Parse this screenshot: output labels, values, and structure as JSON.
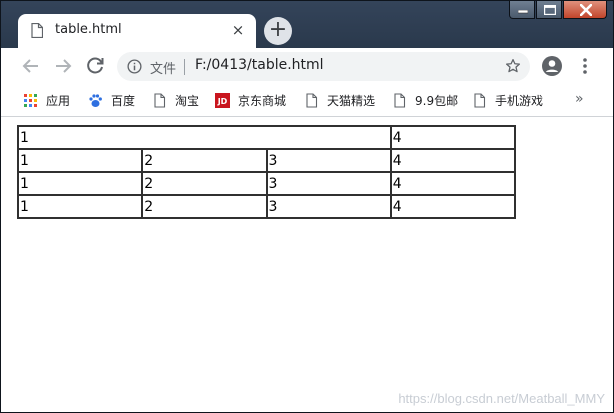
{
  "tab": {
    "title": "table.html",
    "close_glyph": "×"
  },
  "newtab_glyph": "+",
  "toolbar": {
    "scheme_label": "文件",
    "url": "F:/0413/table.html"
  },
  "bookmarks": {
    "items": [
      {
        "label": "应用",
        "icon": "apps-grid-icon"
      },
      {
        "label": "百度",
        "icon": "baidu-paw-icon"
      },
      {
        "label": "淘宝",
        "icon": "page-icon"
      },
      {
        "label": "京东商城",
        "icon": "jd-logo-icon"
      },
      {
        "label": "天猫精选",
        "icon": "page-icon"
      },
      {
        "label": "9.9包邮",
        "icon": "page-icon"
      },
      {
        "label": "手机游戏",
        "icon": "page-icon"
      }
    ],
    "more_glyph": "»",
    "jd_logo_text": "JD"
  },
  "table": {
    "rows": [
      {
        "cells": [
          {
            "text": "1",
            "colspan": 3
          },
          {
            "text": "4",
            "colspan": 1
          }
        ]
      },
      {
        "cells": [
          {
            "text": "1",
            "colspan": 1
          },
          {
            "text": "2",
            "colspan": 1
          },
          {
            "text": "3",
            "colspan": 1
          },
          {
            "text": "4",
            "colspan": 1
          }
        ]
      },
      {
        "cells": [
          {
            "text": "1",
            "colspan": 1
          },
          {
            "text": "2",
            "colspan": 1
          },
          {
            "text": "3",
            "colspan": 1
          },
          {
            "text": "4",
            "colspan": 1
          }
        ]
      },
      {
        "cells": [
          {
            "text": "1",
            "colspan": 1
          },
          {
            "text": "2",
            "colspan": 1
          },
          {
            "text": "3",
            "colspan": 1
          },
          {
            "text": "4",
            "colspan": 1
          }
        ]
      }
    ]
  },
  "watermark": "https://blog.csdn.net/Meatball_MMY",
  "colors": {
    "frame": "#2b3a4e",
    "close_button": "#c2452b",
    "baidu_blue": "#2e6fe0",
    "jd_red": "#c9151e"
  }
}
